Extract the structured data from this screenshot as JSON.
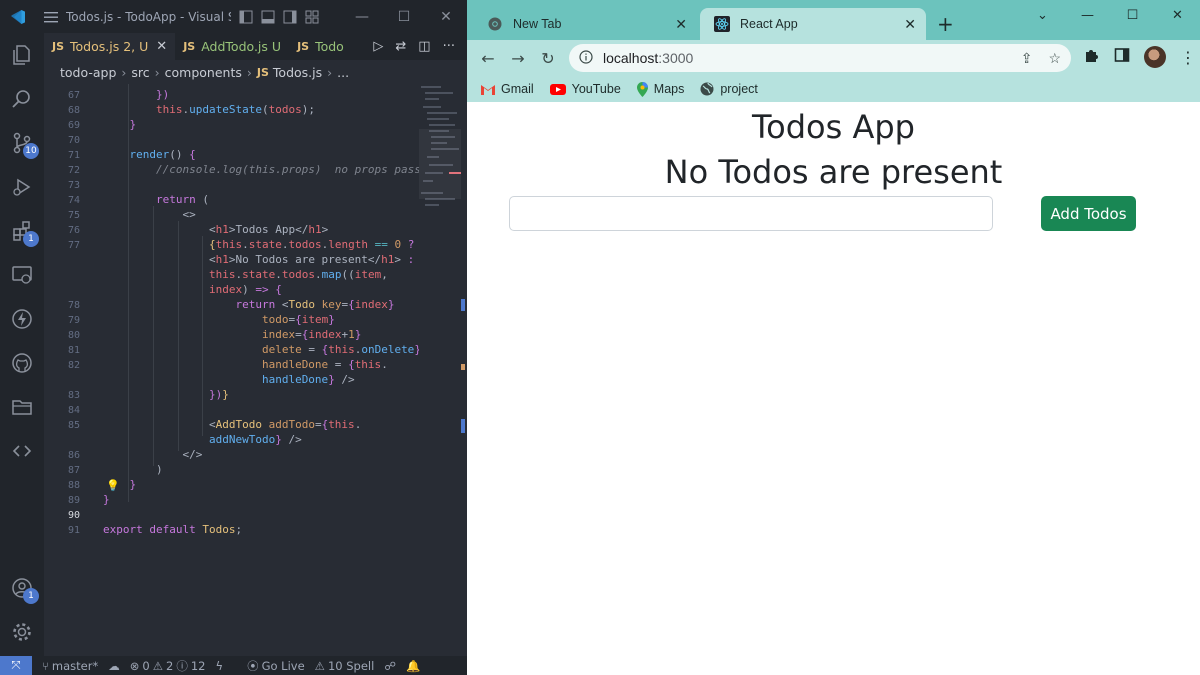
{
  "vscode": {
    "window_title": "Todos.js - TodoApp - Visual S...",
    "tabs": [
      {
        "prefix": "JS",
        "label": "Todos.js",
        "suffix": "2, U"
      },
      {
        "prefix": "JS",
        "label": "AddTodo.js",
        "suffix": "U"
      },
      {
        "prefix": "JS",
        "label": "Todo"
      }
    ],
    "breadcrumb": [
      "todo-app",
      "src",
      "components",
      "Todos.js",
      "..."
    ],
    "activity_badges": {
      "source_control": "10",
      "extensions": "1",
      "accounts": "1"
    },
    "line_numbers": [
      "67",
      "68",
      "69",
      "70",
      "71",
      "72",
      "73",
      "74",
      "75",
      "76",
      "77",
      "78",
      "79",
      "80",
      "81",
      "82",
      "83",
      "84",
      "85",
      "86",
      "87",
      "88",
      "89",
      "90",
      "91"
    ],
    "status": {
      "branch": "master*",
      "errors": "0",
      "warnings": "2",
      "info": "12",
      "go_live": "Go Live",
      "spell": "10 Spell"
    }
  },
  "chrome": {
    "tabs": [
      {
        "label": "New Tab",
        "active": false
      },
      {
        "label": "React App",
        "active": true
      }
    ],
    "url_host": "localhost",
    "url_port": ":3000",
    "bookmarks": [
      "Gmail",
      "YouTube",
      "Maps",
      "project"
    ],
    "colors": {
      "tabbar": "#6cc3bd",
      "toolbar": "#b6e2de",
      "button": "#198754"
    }
  },
  "app": {
    "title": "Todos App",
    "empty_message": "No Todos are present",
    "input_value": "",
    "add_button": "Add Todos"
  }
}
